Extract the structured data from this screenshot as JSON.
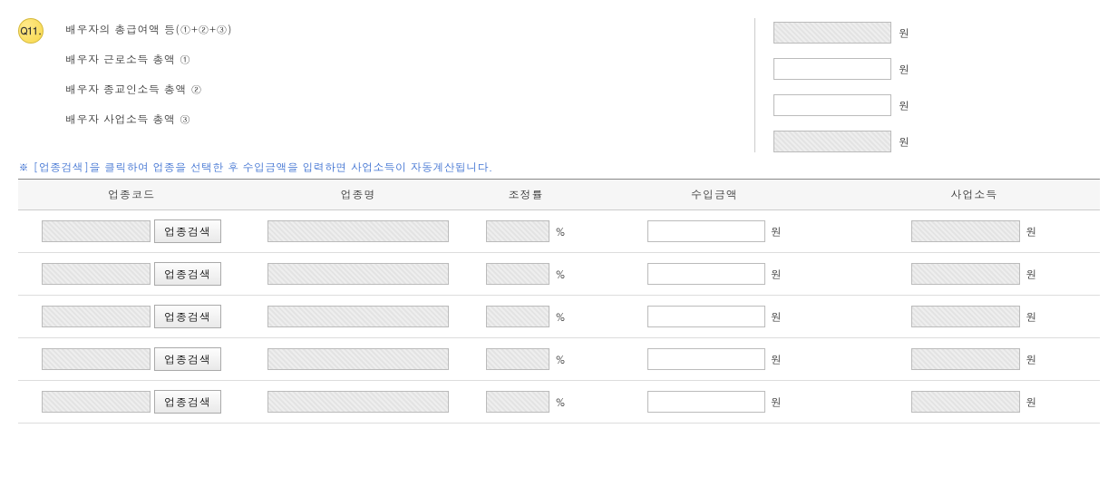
{
  "badge": "Q11.",
  "summary": {
    "total_label": "배우자의 총급여액 등(①+②+③)",
    "labor_label": "배우자 근로소득 총액 ①",
    "relig_label": "배우자 종교인소득 총액 ②",
    "biz_label": "배우자 사업소득 총액 ③",
    "unit": "원",
    "total_val": "",
    "labor_val": "",
    "relig_val": "",
    "biz_val": ""
  },
  "note": "※ [업종검색]을 클릭하여 업종을 선택한 후 수입금액을 입력하면 사업소득이 자동계산됩니다.",
  "table": {
    "headers": {
      "code": "업종코드",
      "name": "업종명",
      "rate": "조정률",
      "revenue": "수입금액",
      "income": "사업소득"
    },
    "search_btn": "업종검색",
    "percent": "%",
    "won": "원",
    "rows": [
      {
        "code": "",
        "name": "",
        "rate": "",
        "revenue": "",
        "income": ""
      },
      {
        "code": "",
        "name": "",
        "rate": "",
        "revenue": "",
        "income": ""
      },
      {
        "code": "",
        "name": "",
        "rate": "",
        "revenue": "",
        "income": ""
      },
      {
        "code": "",
        "name": "",
        "rate": "",
        "revenue": "",
        "income": ""
      },
      {
        "code": "",
        "name": "",
        "rate": "",
        "revenue": "",
        "income": ""
      }
    ]
  }
}
